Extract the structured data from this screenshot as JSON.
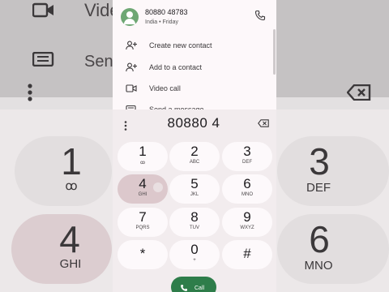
{
  "background": {
    "top_labels": [
      "Vide",
      "Sen"
    ],
    "keys": [
      {
        "digit": "1",
        "letters": "ꝏ"
      },
      {
        "digit": "3",
        "letters": "DEF"
      },
      {
        "digit": "4",
        "letters": "GHI"
      },
      {
        "digit": "6",
        "letters": "MNO"
      }
    ]
  },
  "contact": {
    "number": "80880 48783",
    "meta": "India • Friday",
    "actions": [
      {
        "icon": "add-contact-icon",
        "label": "Create new contact"
      },
      {
        "icon": "add-to-contact-icon",
        "label": "Add to a contact"
      },
      {
        "icon": "video-call-icon",
        "label": "Video call"
      },
      {
        "icon": "message-icon",
        "label": "Send a message"
      }
    ]
  },
  "dialer": {
    "display": "80880 4",
    "keys": [
      {
        "digit": "1",
        "letters": "ꝏ"
      },
      {
        "digit": "2",
        "letters": "ABC"
      },
      {
        "digit": "3",
        "letters": "DEF"
      },
      {
        "digit": "4",
        "letters": "GHI"
      },
      {
        "digit": "5",
        "letters": "JKL"
      },
      {
        "digit": "6",
        "letters": "MNO"
      },
      {
        "digit": "7",
        "letters": "PQRS"
      },
      {
        "digit": "8",
        "letters": "TUV"
      },
      {
        "digit": "9",
        "letters": "WXYZ"
      },
      {
        "digit": "*",
        "letters": ""
      },
      {
        "digit": "0",
        "letters": "+"
      },
      {
        "digit": "#",
        "letters": ""
      }
    ],
    "active_key": "4",
    "call_label": "Call"
  },
  "colors": {
    "call_green": "#2e7d4a",
    "avatar_green": "#6ea774",
    "pressed_key": "#dcc8cc"
  }
}
